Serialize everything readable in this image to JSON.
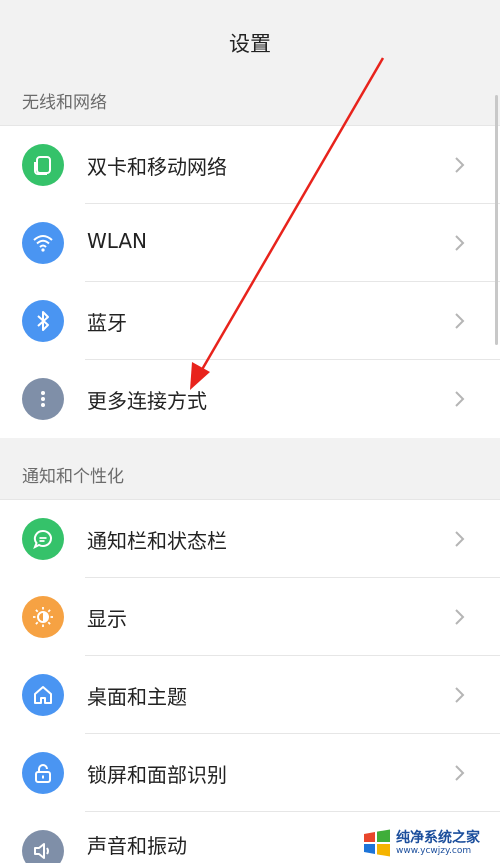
{
  "header": {
    "title": "设置"
  },
  "sections": [
    {
      "title": "无线和网络",
      "items": [
        {
          "label": "双卡和移动网络",
          "icon": "sim-card-icon",
          "color": "#35c26a"
        },
        {
          "label": "WLAN",
          "icon": "wifi-icon",
          "color": "#4a95f2"
        },
        {
          "label": "蓝牙",
          "icon": "bluetooth-icon",
          "color": "#4a95f2"
        },
        {
          "label": "更多连接方式",
          "icon": "more-dots-icon",
          "color": "#7f8fa8"
        }
      ]
    },
    {
      "title": "通知和个性化",
      "items": [
        {
          "label": "通知栏和状态栏",
          "icon": "chat-bubble-icon",
          "color": "#35c26a"
        },
        {
          "label": "显示",
          "icon": "brightness-icon",
          "color": "#f6a243"
        },
        {
          "label": "桌面和主题",
          "icon": "home-icon",
          "color": "#4a95f2"
        },
        {
          "label": "锁屏和面部识别",
          "icon": "lock-icon",
          "color": "#4a95f2"
        },
        {
          "label": "声音和振动",
          "icon": "speaker-icon",
          "color": "#7f8fa8"
        }
      ]
    }
  ],
  "annotation": {
    "arrow_color": "#e8231c"
  },
  "watermark": {
    "main": "纯净系统之家",
    "sub": "www.ycwjzy.com"
  }
}
